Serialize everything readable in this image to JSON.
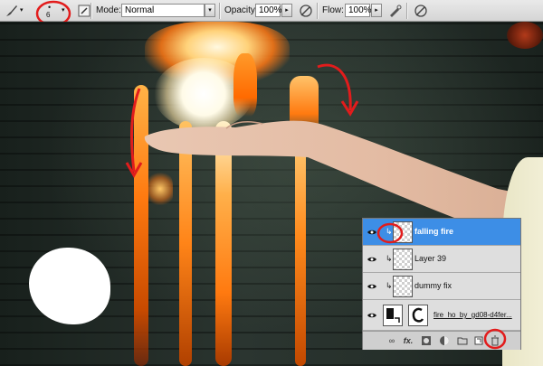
{
  "toolbar": {
    "brush_size": "6",
    "mode_label": "Mode:",
    "mode_value": "Normal",
    "opacity_label": "Opacity:",
    "opacity_value": "100%",
    "flow_label": "Flow:",
    "flow_value": "100%"
  },
  "layers": [
    {
      "name": "falling fire",
      "selected": true
    },
    {
      "name": "Layer 39",
      "selected": false
    },
    {
      "name": "dummy fix",
      "selected": false
    },
    {
      "name": "fire_ho_by_gd08-d4fer...",
      "selected": false
    }
  ],
  "panel_footer": {
    "fx_label": "fx."
  },
  "colors": {
    "selection_blue": "#3d8ee6",
    "annotation_red": "#e21c1c",
    "fire_orange": "#ff8a1c"
  }
}
